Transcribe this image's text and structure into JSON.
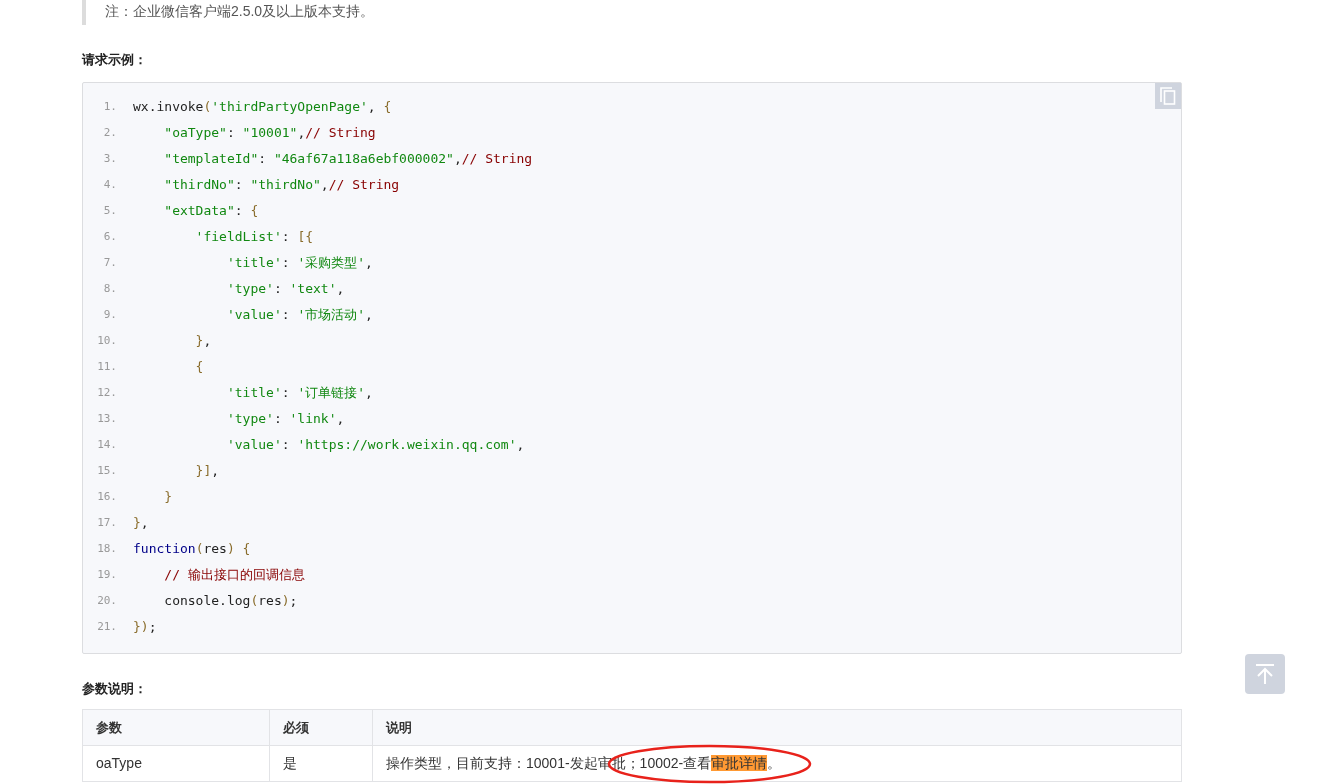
{
  "note": "注：企业微信客户端2.5.0及以上版本支持。",
  "example_heading": "请求示例：",
  "code": {
    "line_numbers": [
      "1.",
      "2.",
      "3.",
      "4.",
      "5.",
      "6.",
      "7.",
      "8.",
      "9.",
      "10.",
      "11.",
      "12.",
      "13.",
      "14.",
      "15.",
      "16.",
      "17.",
      "18.",
      "19.",
      "20.",
      "21."
    ],
    "lines": [
      [
        {
          "kind": "plain",
          "text": "wx.invoke"
        },
        {
          "kind": "punct",
          "text": "("
        },
        {
          "kind": "str",
          "text": "'thirdPartyOpenPage'"
        },
        {
          "kind": "plain",
          "text": ", "
        },
        {
          "kind": "punct",
          "text": "{"
        }
      ],
      [
        {
          "kind": "str",
          "text": "    \"oaType\""
        },
        {
          "kind": "plain",
          "text": ": "
        },
        {
          "kind": "str",
          "text": "\"10001\""
        },
        {
          "kind": "plain",
          "text": ","
        },
        {
          "kind": "comment",
          "text": "// String"
        }
      ],
      [
        {
          "kind": "str",
          "text": "    \"templateId\""
        },
        {
          "kind": "plain",
          "text": ": "
        },
        {
          "kind": "str",
          "text": "\"46af67a118a6ebf000002\""
        },
        {
          "kind": "plain",
          "text": ","
        },
        {
          "kind": "comment",
          "text": "// String"
        }
      ],
      [
        {
          "kind": "str",
          "text": "    \"thirdNo\""
        },
        {
          "kind": "plain",
          "text": ": "
        },
        {
          "kind": "str",
          "text": "\"thirdNo\""
        },
        {
          "kind": "plain",
          "text": ","
        },
        {
          "kind": "comment",
          "text": "// String"
        }
      ],
      [
        {
          "kind": "str",
          "text": "    \"extData\""
        },
        {
          "kind": "plain",
          "text": ": "
        },
        {
          "kind": "punct",
          "text": "{"
        }
      ],
      [
        {
          "kind": "str",
          "text": "        'fieldList'"
        },
        {
          "kind": "plain",
          "text": ": "
        },
        {
          "kind": "punct",
          "text": "[{"
        }
      ],
      [
        {
          "kind": "str",
          "text": "            'title'"
        },
        {
          "kind": "plain",
          "text": ": "
        },
        {
          "kind": "str",
          "text": "'采购类型'"
        },
        {
          "kind": "plain",
          "text": ","
        }
      ],
      [
        {
          "kind": "str",
          "text": "            'type'"
        },
        {
          "kind": "plain",
          "text": ": "
        },
        {
          "kind": "str",
          "text": "'text'"
        },
        {
          "kind": "plain",
          "text": ","
        }
      ],
      [
        {
          "kind": "str",
          "text": "            'value'"
        },
        {
          "kind": "plain",
          "text": ": "
        },
        {
          "kind": "str",
          "text": "'市场活动'"
        },
        {
          "kind": "plain",
          "text": ","
        }
      ],
      [
        {
          "kind": "punct",
          "text": "        }"
        },
        {
          "kind": "plain",
          "text": ","
        }
      ],
      [
        {
          "kind": "punct",
          "text": "        {"
        }
      ],
      [
        {
          "kind": "str",
          "text": "            'title'"
        },
        {
          "kind": "plain",
          "text": ": "
        },
        {
          "kind": "str",
          "text": "'订单链接'"
        },
        {
          "kind": "plain",
          "text": ","
        }
      ],
      [
        {
          "kind": "str",
          "text": "            'type'"
        },
        {
          "kind": "plain",
          "text": ": "
        },
        {
          "kind": "str",
          "text": "'link'"
        },
        {
          "kind": "plain",
          "text": ","
        }
      ],
      [
        {
          "kind": "str",
          "text": "            'value'"
        },
        {
          "kind": "plain",
          "text": ": "
        },
        {
          "kind": "str",
          "text": "'https://work.weixin.qq.com'"
        },
        {
          "kind": "plain",
          "text": ","
        }
      ],
      [
        {
          "kind": "punct",
          "text": "        }]"
        },
        {
          "kind": "plain",
          "text": ","
        }
      ],
      [
        {
          "kind": "punct",
          "text": "    }"
        }
      ],
      [
        {
          "kind": "punct",
          "text": "}"
        },
        {
          "kind": "plain",
          "text": ","
        }
      ],
      [
        {
          "kind": "keyword",
          "text": "function"
        },
        {
          "kind": "punct",
          "text": "("
        },
        {
          "kind": "plain",
          "text": "res"
        },
        {
          "kind": "punct",
          "text": ") {"
        }
      ],
      [
        {
          "kind": "comment",
          "text": "    // 输出接口的回调信息"
        }
      ],
      [
        {
          "kind": "plain",
          "text": "    console.log"
        },
        {
          "kind": "punct",
          "text": "("
        },
        {
          "kind": "plain",
          "text": "res"
        },
        {
          "kind": "punct",
          "text": ")"
        },
        {
          "kind": "plain",
          "text": ";"
        }
      ],
      [
        {
          "kind": "punct",
          "text": "})"
        },
        {
          "kind": "plain",
          "text": ";"
        }
      ]
    ]
  },
  "params_heading": "参数说明：",
  "table": {
    "columns": [
      "参数",
      "必须",
      "说明"
    ],
    "rows": [
      {
        "cells": [
          [
            {
              "text": "oaType",
              "highlight": false
            }
          ],
          [
            {
              "text": "是",
              "highlight": false
            }
          ],
          [
            {
              "text": "操作类型，目前支持：10001-发起审批；10002-查看",
              "highlight": false
            },
            {
              "text": "审批详情",
              "highlight": true
            },
            {
              "text": "。",
              "highlight": false
            }
          ]
        ]
      }
    ],
    "annotations": [
      {
        "kind": "ellipse",
        "color": "#e8221b"
      }
    ]
  }
}
